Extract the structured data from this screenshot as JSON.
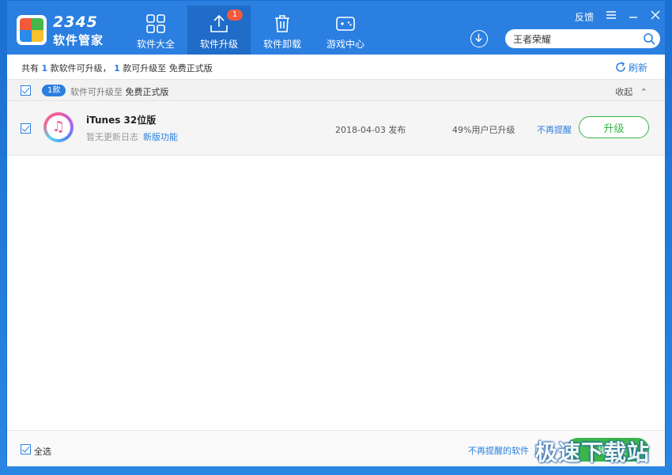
{
  "brand": {
    "number": "2345",
    "name": "软件管家"
  },
  "nav": {
    "tabs": [
      {
        "label": "软件大全",
        "icon": "grid-icon"
      },
      {
        "label": "软件升级",
        "icon": "upload-icon",
        "badge": "1",
        "active": true
      },
      {
        "label": "软件卸载",
        "icon": "trash-icon"
      },
      {
        "label": "游戏中心",
        "icon": "gamepad-icon"
      }
    ]
  },
  "window_controls": {
    "feedback": "反馈",
    "menu": "☰",
    "minimize": "—",
    "close": "✕"
  },
  "search": {
    "value": "王者荣耀"
  },
  "summary": {
    "prefix": "共有",
    "count1": "1",
    "mid1": "款软件可升级，",
    "count2": "1",
    "mid2": "款可升级至",
    "suffix": "免费正式版",
    "refresh_label": "刷新"
  },
  "group": {
    "pill": "1款",
    "text": "软件可升级至",
    "target": "免费正式版",
    "collapse_label": "收起"
  },
  "app": {
    "name": "iTunes 32位版",
    "log": "暂无更新日志",
    "new_features": "新版功能",
    "date": "2018-04-03 发布",
    "upgraded_pct": "49%用户已升级",
    "no_remind": "不再提醒",
    "upgrade_label": "升级"
  },
  "footer": {
    "select_all": "全选",
    "no_remind_software": "不再提醒的软件（",
    "one_key_upgrade": "一键升级"
  },
  "watermark": "极速下载站",
  "colors": {
    "primary": "#2a7fe0",
    "green": "#3ab54a",
    "badge": "#f25a3c"
  }
}
